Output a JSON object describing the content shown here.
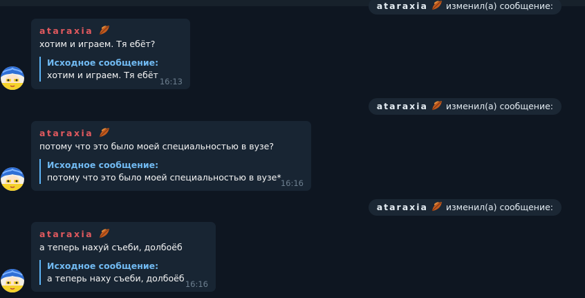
{
  "colors": {
    "background": "#0e1621",
    "bubble": "#182533",
    "service_pill": "#1b2734",
    "author_name": "#e0595e",
    "quote_accent": "#5eb5f7",
    "timestamp": "#6d7f8f"
  },
  "icons": {
    "author_emoji": "fallen-leaf-icon",
    "avatar": "avatar-blue-hair-character"
  },
  "service_messages": [
    {
      "actor": "ataraxia",
      "action": " изменил(а) сообщение:"
    },
    {
      "actor": "ataraxia",
      "action": " изменил(а) сообщение:"
    },
    {
      "actor": "ataraxia",
      "action": " изменил(а) сообщение:"
    }
  ],
  "messages": [
    {
      "author": "ataraxia",
      "text": "хотим и играем. Тя ебёт?",
      "quote_title": "Исходное сообщение:",
      "quote_text": "хотим и играем. Тя ебёт",
      "time": "16:13"
    },
    {
      "author": "ataraxia",
      "text": "потому что это было моей специальностью в вузе?",
      "quote_title": "Исходное сообщение:",
      "quote_text": "потому что это было моей специальностью в вузе*",
      "time": "16:16"
    },
    {
      "author": "ataraxia",
      "text": "а теперь нахуй съеби, долбоёб",
      "quote_title": "Исходное сообщение:",
      "quote_text": "а теперь наху съеби, долбоёб",
      "time": "16:16"
    }
  ]
}
